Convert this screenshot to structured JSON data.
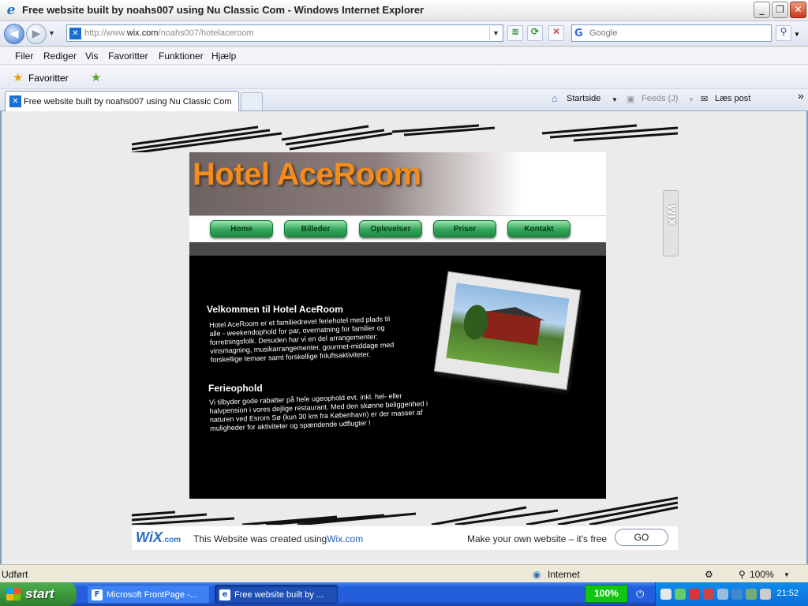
{
  "window": {
    "title": "Free website built by noahs007 using Nu Classic Com - Windows Internet Explorer",
    "min_label": "_",
    "max_label": "❐",
    "close_label": "✕"
  },
  "address_bar": {
    "url_prefix": "http://www.",
    "url_domain": "wix.com",
    "url_path": "/noahs007/hotelaceroom",
    "search_placeholder": "Google"
  },
  "menu": {
    "items": [
      "Filer",
      "Rediger",
      "Vis",
      "Favoritter",
      "Funktioner",
      "Hjælp"
    ]
  },
  "favorites_bar": {
    "label": "Favoritter"
  },
  "tabs": {
    "active_title": "Free website built by noahs007 using Nu Classic Com"
  },
  "command_bar": {
    "home": "Startside",
    "feeds": "Feeds (J)",
    "read_mail": "Læs post",
    "more": "»"
  },
  "site": {
    "logo": "Hotel AceRoom",
    "nav": [
      "Home",
      "Billeder",
      "Oplevelser",
      "Priser",
      "Kontakt"
    ],
    "welcome_heading": "Velkommen til Hotel AceRoom",
    "welcome_lines": [
      "Hotel AceRoom er et familiedrevet feriehotel med plads til",
      "alle - weekendophold for par, overnatning for familier og",
      "forretningsfolk. Desuden har vi en del arrangementer:",
      "vinsmagning, musikarrangementer, gourmet-middage med",
      "forskellige temaer samt forskellige friluftsaktiviteter."
    ],
    "vacation_heading": "Ferieophold",
    "vacation_lines": [
      "Vi tilbyder gode rabatter på hele ugeophold evt. inkl. hel- eller",
      "halvpension i vores dejlige restaurant. Med den skønne beliggenhed i",
      "naturen ved Esrom Sø (kun 30 km fra København) er der masser af",
      "muligheder for aktiviteter og spændende udflugter !"
    ],
    "side_tab": "WIX"
  },
  "wix_footer": {
    "logo": "WiX",
    "logo_suffix": ".com",
    "created_text": "This Website was created using",
    "created_link": "Wix.com",
    "make_text": "Make your own website – it's free",
    "go_label": "GO"
  },
  "status_bar": {
    "status": "Udført",
    "zone": "Internet",
    "zoom": "100%"
  },
  "taskbar": {
    "start": "start",
    "tasks": [
      "Microsoft FrontPage -...",
      "Free website built by ..."
    ],
    "battery": "100%",
    "clock": "21:52"
  }
}
